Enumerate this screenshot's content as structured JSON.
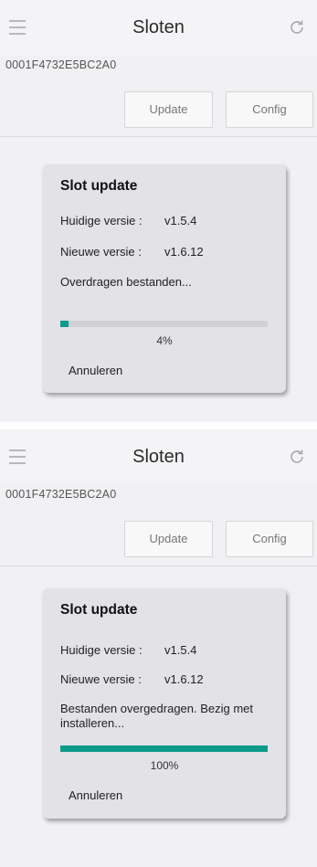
{
  "screens": [
    {
      "header": {
        "title": "Sloten"
      },
      "device_id": "0001F4732E5BC2A0",
      "buttons": {
        "update": "Update",
        "config": "Config"
      },
      "dialog": {
        "title": "Slot update",
        "current_label": "Huidige versie :",
        "current_value": "v1.5.4",
        "new_label": "Nieuwe versie :",
        "new_value": "v1.6.12",
        "status": "Overdragen bestanden...",
        "progress_value": 0.04,
        "progress_label": "4%",
        "cancel": "Annuleren"
      }
    },
    {
      "header": {
        "title": "Sloten"
      },
      "device_id": "0001F4732E5BC2A0",
      "buttons": {
        "update": "Update",
        "config": "Config"
      },
      "dialog": {
        "title": "Slot update",
        "current_label": "Huidige versie :",
        "current_value": "v1.5.4",
        "new_label": "Nieuwe versie :",
        "new_value": "v1.6.12",
        "status": "Bestanden overgedragen. Bezig met installeren...",
        "progress_value": 1.0,
        "progress_label": "100%",
        "cancel": "Annuleren"
      }
    }
  ],
  "icons": {
    "menu": "hamburger-menu-icon",
    "refresh": "refresh-icon"
  },
  "colors": {
    "accent": "#0e9a8a",
    "dialog_bg": "#e2e2e7",
    "screen_bg": "#f1f1f3"
  }
}
